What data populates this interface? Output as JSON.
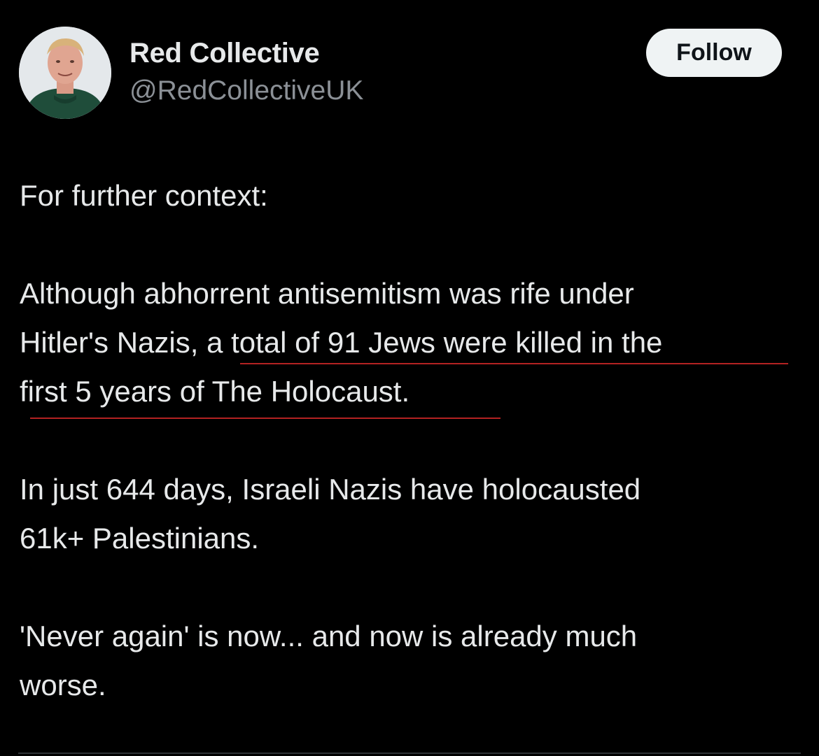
{
  "author": {
    "display_name": "Red Collective",
    "handle": "@RedCollectiveUK",
    "avatar_icon": "profile-photo"
  },
  "follow_button": {
    "label": "Follow"
  },
  "post": {
    "intro": "For further context:",
    "paragraph1": {
      "line1": "Although abhorrent antisemitism was rife under",
      "line2_start": "Hitler's Nazis, ",
      "line2_highlight": "a total of 91 Jews were killed in the",
      "line3_highlight": "first 5 years of The Holocaust."
    },
    "paragraph2": {
      "line1": "In just 644 days, Israeli Nazis have holocausted",
      "line2": "61k+ Palestinians."
    },
    "paragraph3": {
      "line1": "'Never again' is now... and now is already much",
      "line2": "worse."
    }
  },
  "colors": {
    "background": "#000000",
    "text": "#e7e9ea",
    "secondary_text": "#8b9096",
    "underline_annotation": "#b32222",
    "follow_button_bg": "#eff3f4"
  }
}
